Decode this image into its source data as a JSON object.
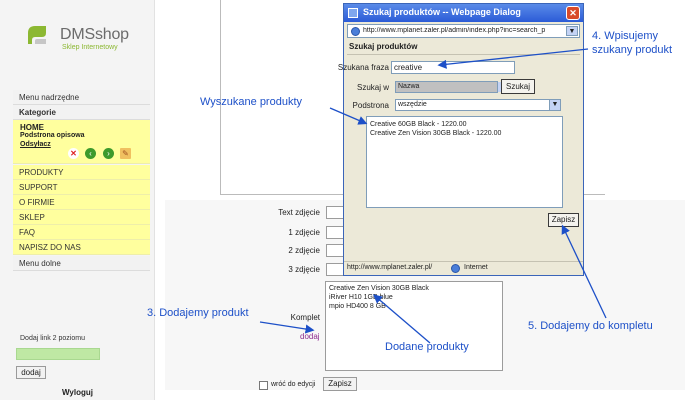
{
  "logo": {
    "title": "DMSshop",
    "subtitle": "Sklep Internetowy",
    "mark_color": "#8cb832"
  },
  "sidebar": {
    "menu_parent": "Menu nadrzędne",
    "categories": "Kategorie",
    "home": {
      "title": "HOME",
      "subtitle": "Podstrona opisowa",
      "link": "Odsyłacz"
    },
    "items": [
      "PRODUKTY",
      "SUPPORT",
      "O FIRMIE",
      "SKLEP",
      "FAQ",
      "NAPISZ DO NAS"
    ],
    "menu_bottom": "Menu dolne",
    "add_level": {
      "label": "Dodaj link 2 poziomu",
      "button": "dodaj"
    },
    "logout": "Wyloguj"
  },
  "form": {
    "labels": [
      "Text zdjęcie",
      "1 zdjęcie",
      "2 zdjęcie",
      "3 zdjęcie"
    ],
    "komplet_label": "Komplet",
    "komplet_link": "dodaj",
    "komplet_items": [
      "Creative Zen Vision 30GB Black",
      "iRiver H10 1GB blue",
      "mpio HD400 8 GB"
    ],
    "return_label": "wróć do edycji",
    "save": "Zapisz"
  },
  "dialog": {
    "title": "Szukaj produktów -- Webpage Dialog",
    "url": "http://www.mplanet.zaler.pl/admin/index.php?inc=search_p",
    "header": "Szukaj produktów",
    "phrase_label": "Szukana fraza",
    "phrase_value": "creative",
    "field_label": "Szukaj w",
    "field_value": "Nazwa",
    "search_button": "Szukaj",
    "page_label": "Podstrona",
    "page_value": "wszędzie",
    "results": [
      "Creative 60GB Black - 1220.00",
      "Creative Zen Vision 30GB Black - 1220.00"
    ],
    "save_button": "Zapisz",
    "status_url": "http://www.mplanet.zaler.pl/",
    "status_zone": "Internet"
  },
  "annotations": {
    "step4_line1": "4. Wpisujemy",
    "step4_line2": "szukany produkt",
    "found": "Wyszukane produkty",
    "step3": "3. Dodajemy produkt",
    "added": "Dodane produkty",
    "step5": "5. Dodajemy do kompletu",
    "color": "#1d50c8"
  }
}
